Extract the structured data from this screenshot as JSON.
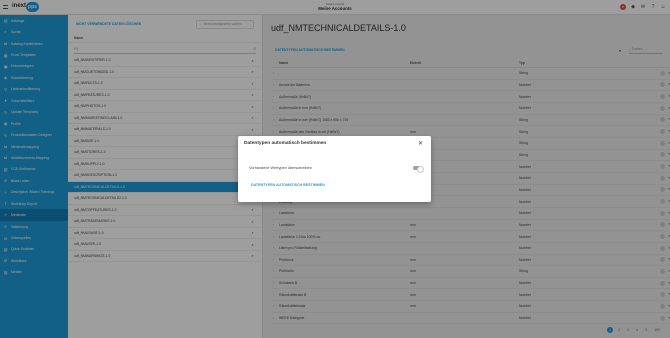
{
  "topbar": {
    "logo": "inext",
    "logo_badge": "pps",
    "subtitle": "Saebo GmbH",
    "title": "Meine Accounts",
    "icons": [
      "notification-icon",
      "cube-icon",
      "mail-icon",
      "help-icon",
      "user-icon"
    ]
  },
  "sidebar": {
    "items": [
      {
        "label": "Kataloge",
        "icon": "▤"
      },
      {
        "label": "Suche",
        "icon": "⌕"
      },
      {
        "label": "Katalog Kombinieren",
        "icon": "⇄"
      },
      {
        "label": "Excel Templates",
        "icon": "▦"
      },
      {
        "label": "Dokumentypen",
        "icon": "▣"
      },
      {
        "label": "Klassifizierung",
        "icon": "◈"
      },
      {
        "label": "Lieferantenfilterung",
        "icon": "⚲"
      },
      {
        "label": "Gutscheinfilters",
        "icon": "✦"
      },
      {
        "label": "Update Templates",
        "icon": "↻"
      },
      {
        "label": "Profile",
        "icon": "◉"
      },
      {
        "label": "Produktionsdaten Designer",
        "icon": "✎"
      },
      {
        "label": "Merkmalsmapping",
        "icon": "⇆"
      },
      {
        "label": "Artikelnummern-Mapping",
        "icon": "⇄"
      },
      {
        "label": "CCE Sortimente",
        "icon": "▥"
      },
      {
        "label": "Black Listen",
        "icon": "⊘"
      },
      {
        "label": "Description Wizard Trainings",
        "icon": "✧"
      },
      {
        "label": "Workshop Export",
        "icon": "⇪"
      },
      {
        "label": "Merkmale",
        "icon": "≡"
      },
      {
        "label": "Validierung",
        "icon": "✔"
      },
      {
        "label": "Datenquellen",
        "icon": "⛁"
      },
      {
        "label": "Quick Sortimen",
        "icon": "▧"
      },
      {
        "label": "Workflows",
        "icon": "⚙"
      },
      {
        "label": "Medien",
        "icon": "▨"
      }
    ],
    "active_index": 17
  },
  "list_panel": {
    "header_link": "NICHT VERWENDETE DATEN LÖSCHEN",
    "search_placeholder": "Berechnungsname suchen",
    "column_header": "Name",
    "filter_placeholder": "Fil",
    "rows": [
      "udf_NMIDENTIFIER-1.0",
      "udf_NMCUSTOMIZED-1.0",
      "udf_NMFACTS-1.0",
      "udf_NMFEATURES-1.0",
      "udf_NMPHOTOS-1.0",
      "udf_NMMARKETINGCLAIM-1.0",
      "udf_NMMATERIALS-1.0",
      "udf_NMSIZE-1.0",
      "udf_NMSTORES-1.0",
      "udf_NMSUPPLY-1.0",
      "udf_NMSDESCRIPTION-1.0",
      "udf_NMTECHNICALDETAILS-1.0",
      "udf_NMTECHNICALDETAILS2-1.0",
      "udf_NMTOPFEATURES-1.0",
      "udf_NMTRADEMARKS-1.0",
      "udf_NMUSAGE-1.0",
      "udf_NMUSER-1.0",
      "udf_NMWARNINGS-1.0"
    ],
    "selected_index": 11
  },
  "detail": {
    "title": "udf_NMTECHNICALDETAILS-1.0",
    "toolbar_link": "DATENTYPEN AUTOMATISCH BESTIMMEN",
    "search_placeholder": "Suchen ...",
    "columns": {
      "name": "Name",
      "einheit": "Einheit",
      "typ": "Typ"
    },
    "rows": [
      {
        "name": "",
        "einheit": "",
        "typ": "String"
      },
      {
        "name": "Anzahl der Batterien",
        "einheit": "",
        "typ": "Number"
      },
      {
        "name": "Außenmaße (HxBxT)",
        "einheit": "",
        "typ": "Number"
      },
      {
        "name": "Außenmaße in mm (HxBxT)",
        "einheit": "",
        "typ": "Number"
      },
      {
        "name": "Außenmaße in mm (HxBxT) 1083 x 550 x 719",
        "einheit": "",
        "typ": "String"
      },
      {
        "name": "Außenmaße des Gerätes in cm (HxBxT)",
        "einheit": "mm",
        "typ": "String"
      },
      {
        "name": "",
        "einheit": "mm",
        "typ": "String"
      },
      {
        "name": "",
        "einheit": "",
        "typ": "String"
      },
      {
        "name": "",
        "einheit": "",
        "typ": "Number"
      },
      {
        "name": "",
        "einheit": "",
        "typ": "Number"
      },
      {
        "name": "",
        "einheit": "mm",
        "typ": "Number"
      },
      {
        "name": "Leistung",
        "einheit": "",
        "typ": "Number"
      },
      {
        "name": "Laststrom",
        "einheit": "",
        "typ": "Number"
      },
      {
        "name": "Lautstärke",
        "einheit": "mm",
        "typ": "Number"
      },
      {
        "name": "Lautstärke 2,5 bis 100% ca.",
        "einheit": "mm",
        "typ": "Number"
      },
      {
        "name": "Litern pro Füllstellsstrang",
        "einheit": "",
        "typ": "Number"
      },
      {
        "name": "Prüfdruck",
        "einheit": "mm",
        "typ": "Number"
      },
      {
        "name": "Prüfmaße",
        "einheit": "mm",
        "typ": "String"
      },
      {
        "name": "Schuberis B",
        "einheit": "mm",
        "typ": "Number"
      },
      {
        "name": "Räumkräfteratio B",
        "einheit": "mm",
        "typ": "Number"
      },
      {
        "name": "Räumkräfteinsatz",
        "einheit": "mm",
        "typ": "Number"
      },
      {
        "name": "WEEE Kategorie",
        "einheit": "",
        "typ": "Number"
      }
    ],
    "pager": [
      "1",
      "2",
      "3",
      "4",
      "5",
      "100"
    ],
    "pager_active": 0
  },
  "modal": {
    "title": "Datentypen automatisch bestimmen",
    "close_glyph": "✕",
    "option_label": "Vorhandene Wertypen überschreiben",
    "option_checked": false,
    "action_label": "DATENTYPEN AUTOMATISCH BESTIMMEN"
  }
}
